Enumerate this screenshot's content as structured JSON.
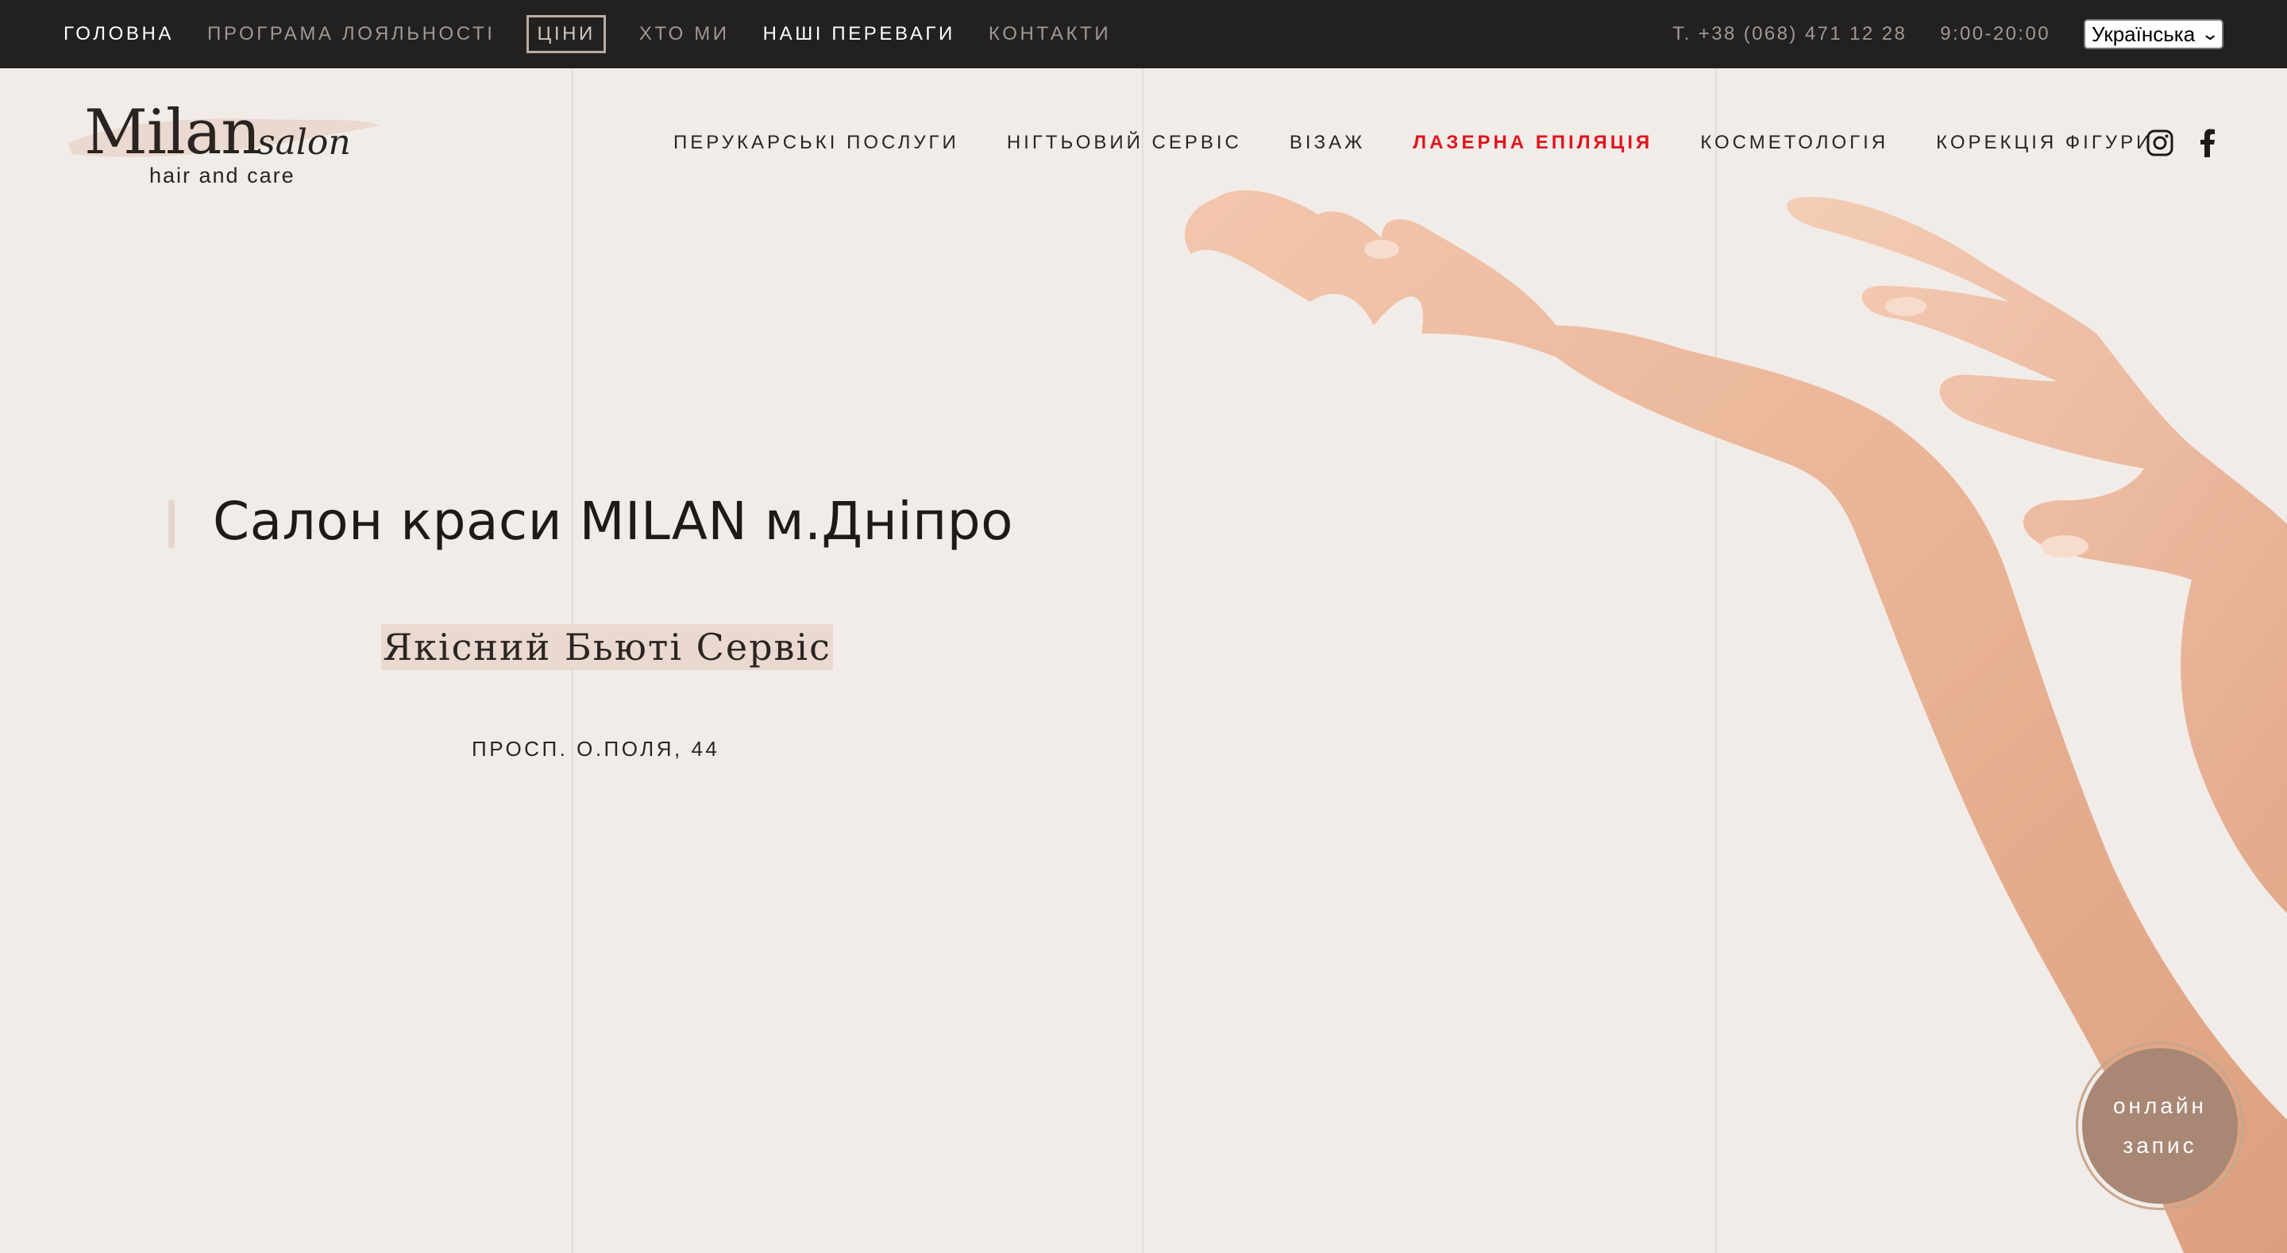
{
  "topbar": {
    "links": [
      {
        "label": "ГОЛОВНА",
        "name": "topnav-home",
        "bright": true
      },
      {
        "label": "ПРОГРАМА ЛОЯЛЬНОСТІ",
        "name": "topnav-loyalty"
      },
      {
        "label": "ЦІНИ",
        "name": "topnav-prices",
        "boxed": true
      },
      {
        "label": "ХТО МИ",
        "name": "topnav-about"
      },
      {
        "label": "НАШІ ПЕРЕВАГИ",
        "name": "topnav-advantages",
        "bright": true
      },
      {
        "label": "КОНТАКТИ",
        "name": "topnav-contacts"
      }
    ],
    "phone": "T. +38 (068) 471 12 28",
    "hours": "9:00-20:00",
    "language": "Українська"
  },
  "logo": {
    "main": "Milan",
    "script": "salon",
    "tagline": "hair and care"
  },
  "main_nav": [
    {
      "label": "ПЕРУКАРСЬКІ ПОСЛУГИ",
      "name": "nav-hair"
    },
    {
      "label": "НІГТЬОВИЙ СЕРВІС",
      "name": "nav-nails"
    },
    {
      "label": "ВІЗАЖ",
      "name": "nav-makeup"
    },
    {
      "label": "ЛАЗЕРНА ЕПІЛЯЦІЯ",
      "name": "nav-laser",
      "accent": true
    },
    {
      "label": "КОСМЕТОЛОГІЯ",
      "name": "nav-cosmetology"
    },
    {
      "label": "КОРЕКЦІЯ ФІГУРИ",
      "name": "nav-body"
    }
  ],
  "social": [
    "instagram-icon",
    "facebook-icon"
  ],
  "hero": {
    "title": "Салон краси MILAN м.Дніпро",
    "subtitle": "Якісний Бьюті Сервіс",
    "address": "ПРОСП. О.ПОЛЯ, 44"
  },
  "booking": {
    "line1": "онлайн",
    "line2": "запис"
  },
  "colors": {
    "topbar_bg": "#222120",
    "page_bg": "#f2ece9",
    "accent_red": "#e0141e",
    "booking_fill": "#a88774",
    "highlight": "#ead9d0"
  }
}
